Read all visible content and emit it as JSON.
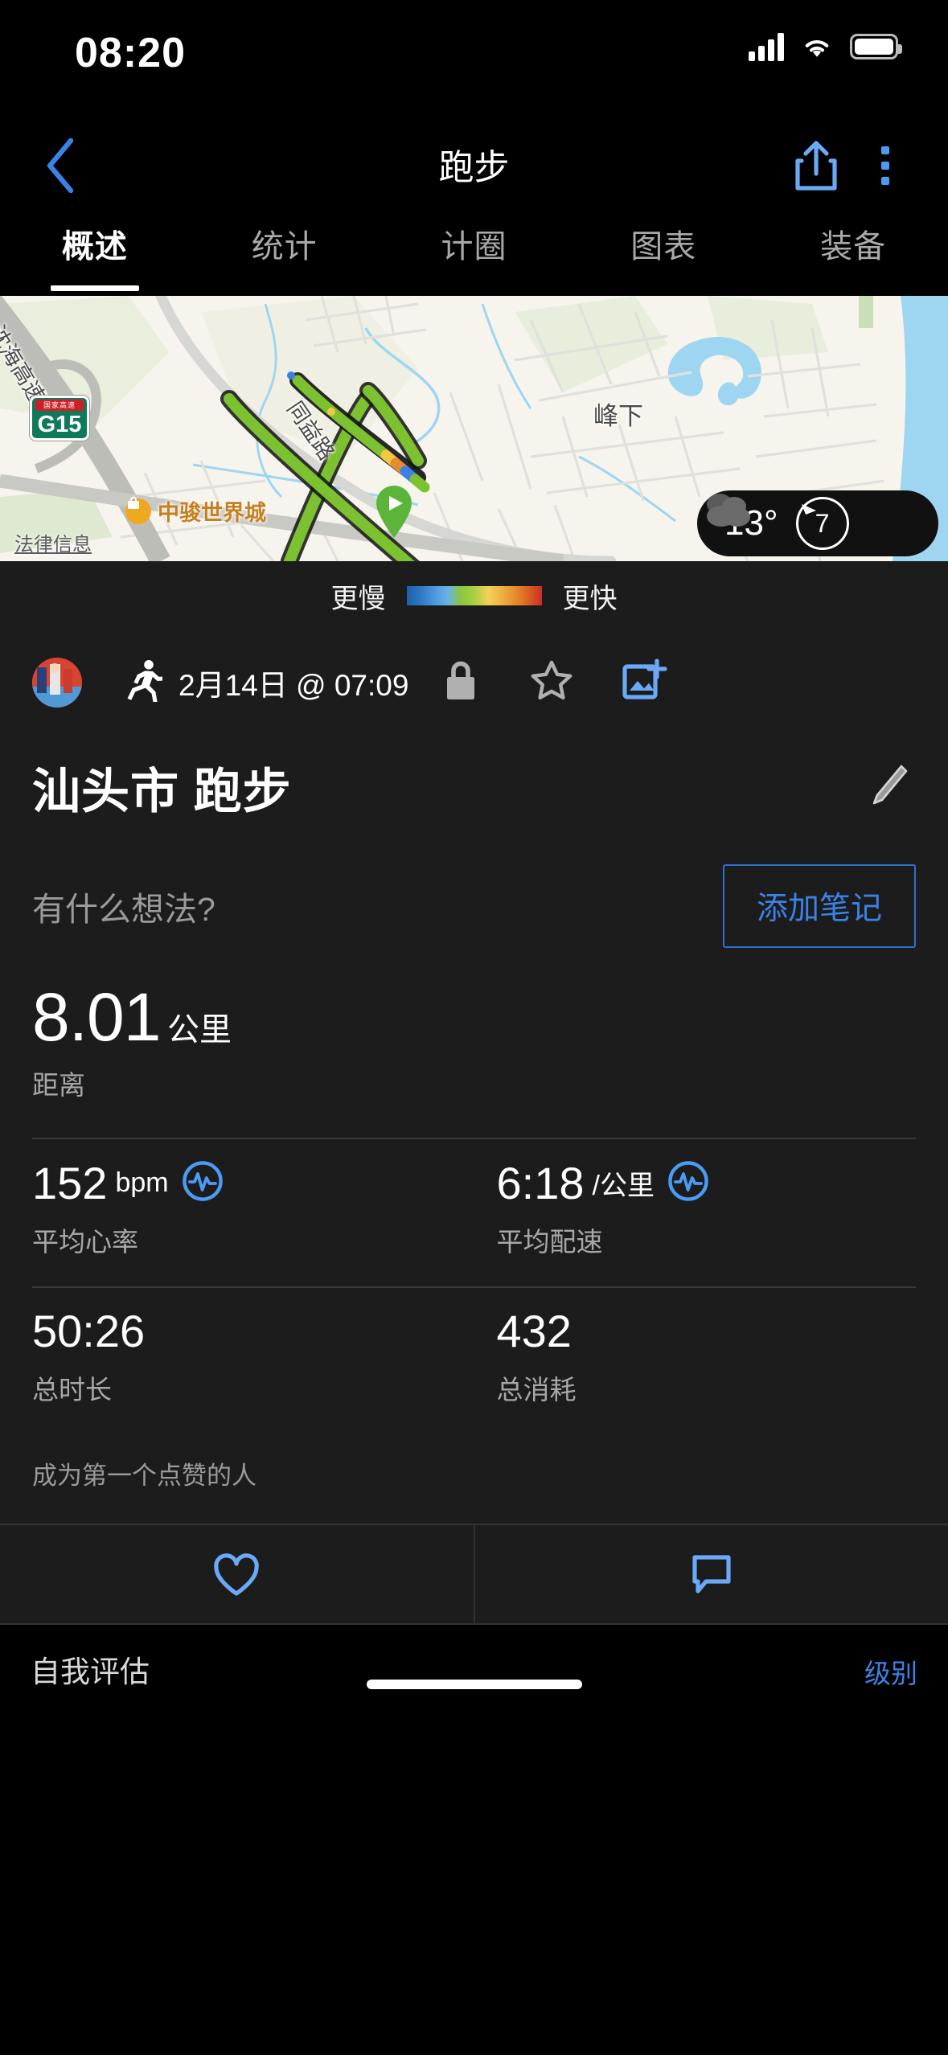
{
  "status_bar": {
    "time": "08:20",
    "icons": [
      "cellular-signal-icon",
      "wifi-icon",
      "battery-icon"
    ]
  },
  "nav": {
    "back_icon": "chevron-left-icon",
    "title": "跑步",
    "share_icon": "share-icon",
    "more_icon": "more-vertical-icon"
  },
  "tabs": [
    {
      "label": "概述",
      "active": true
    },
    {
      "label": "统计",
      "active": false
    },
    {
      "label": "计圈",
      "active": false
    },
    {
      "label": "图表",
      "active": false
    },
    {
      "label": "装备",
      "active": false
    }
  ],
  "map": {
    "labels": [
      {
        "text": "沈海高速"
      },
      {
        "text": "同益路"
      },
      {
        "text": "峰下"
      }
    ],
    "highway_shield": {
      "banner": "国家高速",
      "code": "G15"
    },
    "poi": {
      "name": "中骏世界城"
    },
    "legal": "法律信息",
    "start_marker_icon": "play-pin-icon",
    "weather": {
      "temperature": "13°",
      "condition_icon": "cloudy-icon",
      "wind": "7",
      "wind_icon": "wind-direction-icon"
    }
  },
  "pace_legend": {
    "slower_label": "更慢",
    "faster_label": "更快",
    "colors": [
      "#1f5fa9",
      "#2f78c4",
      "#4a97dd",
      "#69b1ea",
      "#8cc63f",
      "#a8cf45",
      "#f2d15a",
      "#efb142",
      "#e78c2e",
      "#d8621f",
      "#cc2e26"
    ]
  },
  "activity": {
    "avatar_icon": "user-avatar",
    "type_icon": "running-icon",
    "date": "2月14日 @ 07:09",
    "privacy_icon": "lock-icon",
    "star_icon": "star-outline-icon",
    "add_photo_icon": "add-photo-icon",
    "title": "汕头市 跑步",
    "edit_icon": "pencil-icon",
    "note_placeholder": "有什么想法?",
    "add_note_label": "添加笔记"
  },
  "stats": {
    "hero": {
      "value": "8.01",
      "unit": "公里",
      "label": "距离"
    },
    "cells": [
      {
        "value": "152",
        "unit": "bpm",
        "label": "平均心率",
        "icon": "pulse-badge-icon"
      },
      {
        "value": "6:18",
        "unit": "/公里",
        "label": "平均配速",
        "icon": "pulse-badge-icon"
      },
      {
        "value": "50:26",
        "unit": "",
        "label": "总时长",
        "icon": ""
      },
      {
        "value": "432",
        "unit": "",
        "label": "总消耗",
        "icon": ""
      }
    ]
  },
  "social": {
    "kudos_text": "成为第一个点赞的人",
    "like_icon": "heart-outline-icon",
    "comment_icon": "comment-icon"
  },
  "footer": {
    "self_assessment": "自我评估",
    "action_label": "级别"
  },
  "colors": {
    "accent": "#3b82e6",
    "background": "#1c1c1c",
    "nav_background": "#000000",
    "text_primary": "#ffffff",
    "text_secondary": "#a8a8a8",
    "route": "#7cc12f"
  }
}
